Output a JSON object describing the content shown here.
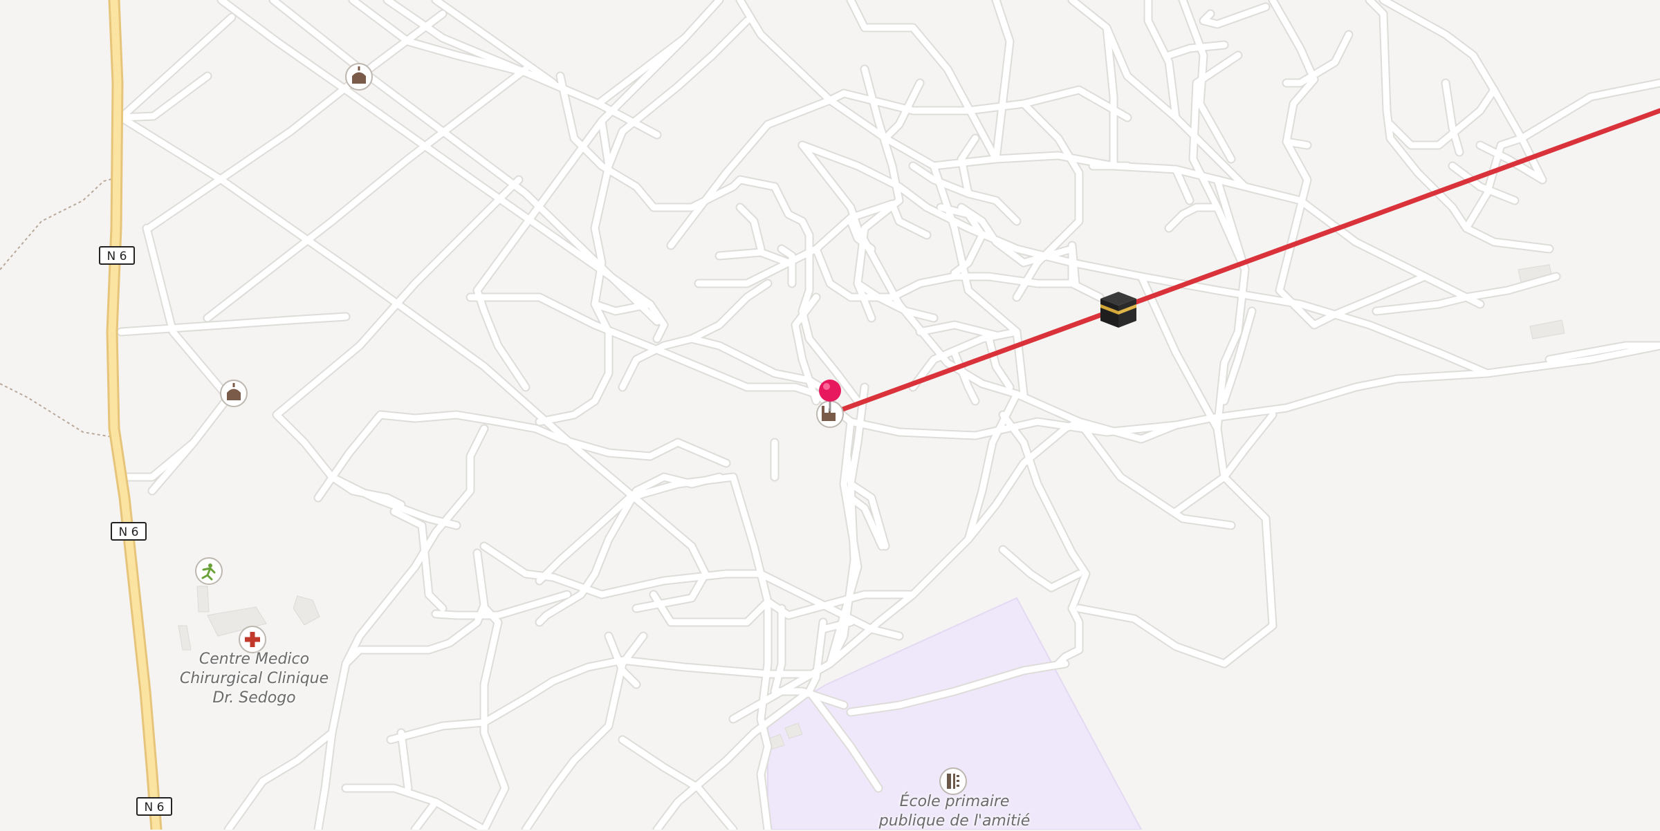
{
  "map": {
    "road_shield_label": "N 6",
    "labels": {
      "clinic_line1": "Centre Medico",
      "clinic_line2": "Chirurgical Clinique",
      "clinic_line3": "Dr. Sedogo",
      "school_line1": "École primaire",
      "school_line2": "publique de l'amitié"
    },
    "icons": [
      "mosque-icon",
      "sports-icon",
      "hospital-icon",
      "school-icon",
      "kaaba-icon",
      "location-pin-icon"
    ],
    "colors": {
      "background": "#f5f4f2",
      "road": "#ffffff",
      "road_casing": "#dedcd8",
      "highway": "#fbe3a1",
      "highway_casing": "#e6c57a",
      "school_area": "#efe8fa",
      "qibla_line": "#d9323a",
      "pin": "#e8185e"
    }
  }
}
